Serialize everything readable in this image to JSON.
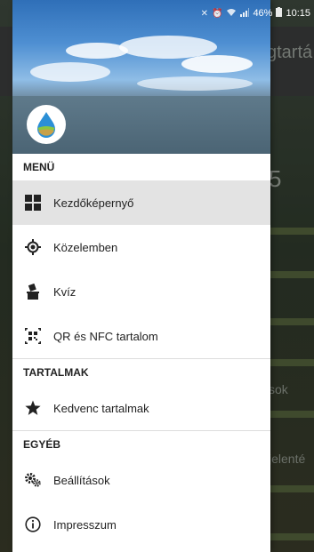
{
  "status_bar": {
    "battery": "46%",
    "time": "10:15"
  },
  "background_app": {
    "title": "gtartá",
    "big_text": "5",
    "row_text_1": "sok",
    "row_text_2": "jelenté"
  },
  "drawer": {
    "sections": [
      {
        "label": "MENÜ",
        "items": [
          {
            "label": "Kezdőképernyő",
            "icon": "grid-icon",
            "active": true
          },
          {
            "label": "Közelemben",
            "icon": "location-target-icon",
            "active": false
          },
          {
            "label": "Kvíz",
            "icon": "ballot-box-icon",
            "active": false
          },
          {
            "label": "QR és NFC tartalom",
            "icon": "qr-code-icon",
            "active": false
          }
        ]
      },
      {
        "label": "TARTALMAK",
        "items": [
          {
            "label": "Kedvenc tartalmak",
            "icon": "star-icon",
            "active": false
          }
        ]
      },
      {
        "label": "EGYÉB",
        "items": [
          {
            "label": "Beállítások",
            "icon": "gears-icon",
            "active": false
          },
          {
            "label": "Impresszum",
            "icon": "info-icon",
            "active": false
          }
        ]
      }
    ]
  }
}
